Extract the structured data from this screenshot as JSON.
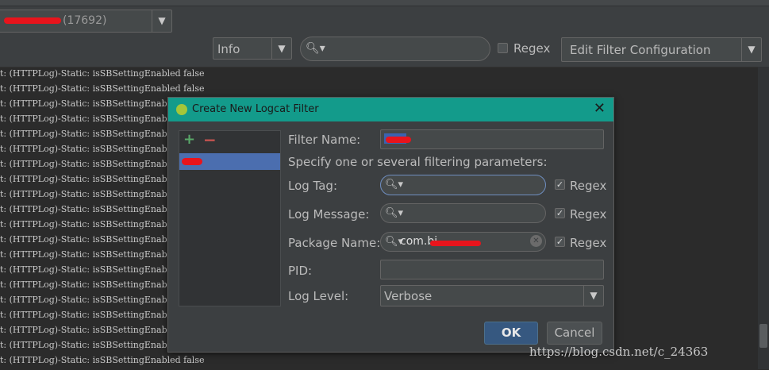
{
  "toolbar": {
    "process_name": "",
    "process_pid": "(17692)",
    "log_level": "Info",
    "search_value": "",
    "regex_label": "Regex",
    "filter_config": "Edit Filter Configuration"
  },
  "log": {
    "lines": [
      "t: (HTTPLog)-Static: isSBSettingEnabled false",
      "t: (HTTPLog)-Static: isSBSettingEnabled false",
      "t: (HTTPLog)-Static: isSBSettingEnabled false",
      "t: (HTTPLog)-Static: isSBSettingEnabled false",
      "t: (HTTPLog)-Static: isSBSettingEnabled false",
      "t: (HTTPLog)-Static: isSBSettingEnabled false",
      "t: (HTTPLog)-Static: isSBSettingEnabled false",
      "t: (HTTPLog)-Static: isSBSettingEnabled false",
      "t: (HTTPLog)-Static: isSBSettingEnabled false",
      "t: (HTTPLog)-Static: isSBSettingEnabled false",
      "t: (HTTPLog)-Static: isSBSettingEnabled false",
      "t: (HTTPLog)-Static: isSBSettingEnabled false",
      "t: (HTTPLog)-Static: isSBSettingEnabled false",
      "t: (HTTPLog)-Static: isSBSettingEnabled false",
      "t: (HTTPLog)-Static: isSBSettingEnabled false",
      "t: (HTTPLog)-Static: isSBSettingEnabled false",
      "t: (HTTPLog)-Static: isSBSettingEnabled false",
      "t: (HTTPLog)-Static: isSBSettingEnabled false",
      "t: (HTTPLog)-Static: isSBSettingEnabled false",
      "t: (HTTPLog)-Static: isSBSettingEnabled false"
    ]
  },
  "dialog": {
    "title": "Create New Logcat Filter",
    "close_glyph": "✕",
    "add_glyph": "+",
    "remove_glyph": "−",
    "filter_name_label": "Filter Name:",
    "instructions": "Specify one or several filtering parameters:",
    "log_tag_label": "Log Tag:",
    "log_tag_value": "",
    "log_message_label": "Log Message:",
    "log_message_value": "",
    "package_name_label": "Package Name:",
    "package_name_value": "com.bi",
    "pid_label": "PID:",
    "pid_value": "",
    "log_level_label": "Log Level:",
    "log_level_value": "Verbose",
    "regex_label": "Regex",
    "ok_label": "OK",
    "cancel_label": "Cancel"
  },
  "watermark": "https://blog.csdn.net/c_24363",
  "colors": {
    "background": "#2b2b2b",
    "panel": "#3c3f41",
    "title_bar": "#139b8b",
    "selection": "#4b6eaf",
    "redaction": "#e8141c",
    "ok_button": "#365880"
  }
}
